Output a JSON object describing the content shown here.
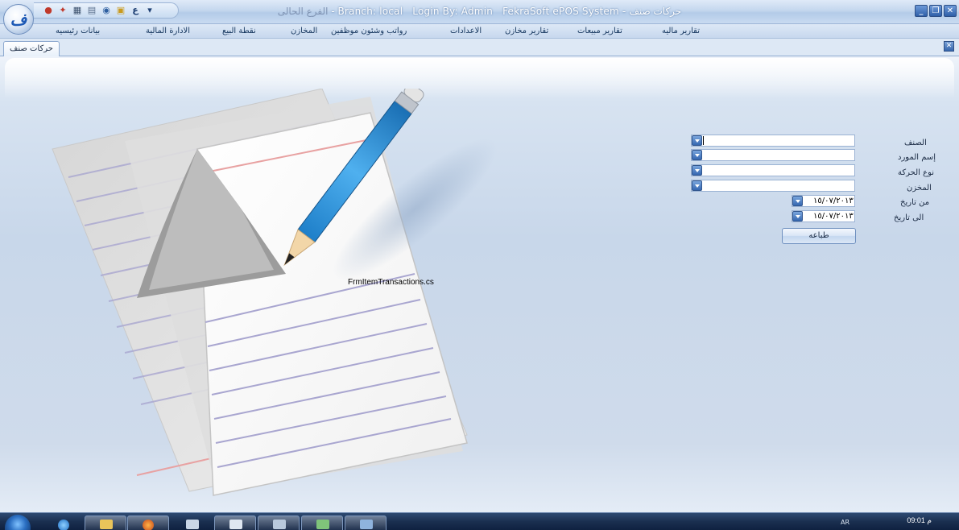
{
  "window": {
    "title_module": "حركات صنف",
    "title_app": "FekraSoft ePOS System",
    "login": "Login By: Admin",
    "branch": "Branch: local",
    "branch_current": "الفرع الحالى",
    "separator": "-",
    "minimize_glyph": "_",
    "restore_glyph": "❐",
    "close_glyph": "✕"
  },
  "app_menu": {
    "orb_glyph": "ف"
  },
  "quick_access": {
    "icons": [
      "palette-icon",
      "pin-icon",
      "calculator-icon",
      "notepad-icon",
      "eye-icon",
      "lock-icon",
      "language-icon",
      "dropdown-icon"
    ],
    "language_glyph": "ع",
    "dropdown_glyph": "▾"
  },
  "menu": {
    "items": [
      "تقارير ماليه",
      "تقارير مبيعات",
      "تقارير مخازن",
      "الاعدادات",
      "رواتب وشئون موظفين",
      "المخازن",
      "نقطة البيع",
      "الادارة المالية",
      "بيانات رئيسيه"
    ]
  },
  "tabs": {
    "active_label": "حركات صنف",
    "close_glyph": "✕"
  },
  "content": {
    "caption": "FrmItemTransactions.cs"
  },
  "form": {
    "item_label": "الصنف",
    "supplier_label": "إسم المورد",
    "movement_type_label": "نوع الحركة",
    "store_label": "المخزن",
    "from_date_label": "من تاريخ",
    "to_date_label": "الى تاريخ",
    "item_value": "",
    "supplier_value": "",
    "movement_type_value": "",
    "store_value": "",
    "from_date_value": "١٥/٠٧/٢٠١٣",
    "to_date_value": "١٥/٠٧/٢٠١٣",
    "print_label": "طباعه"
  },
  "taskbar": {
    "time": "09:01 م",
    "language": "AR"
  },
  "colors": {
    "accent": "#3567b1",
    "background": "#c9d8ea",
    "taskbar": "#1a2f50"
  }
}
